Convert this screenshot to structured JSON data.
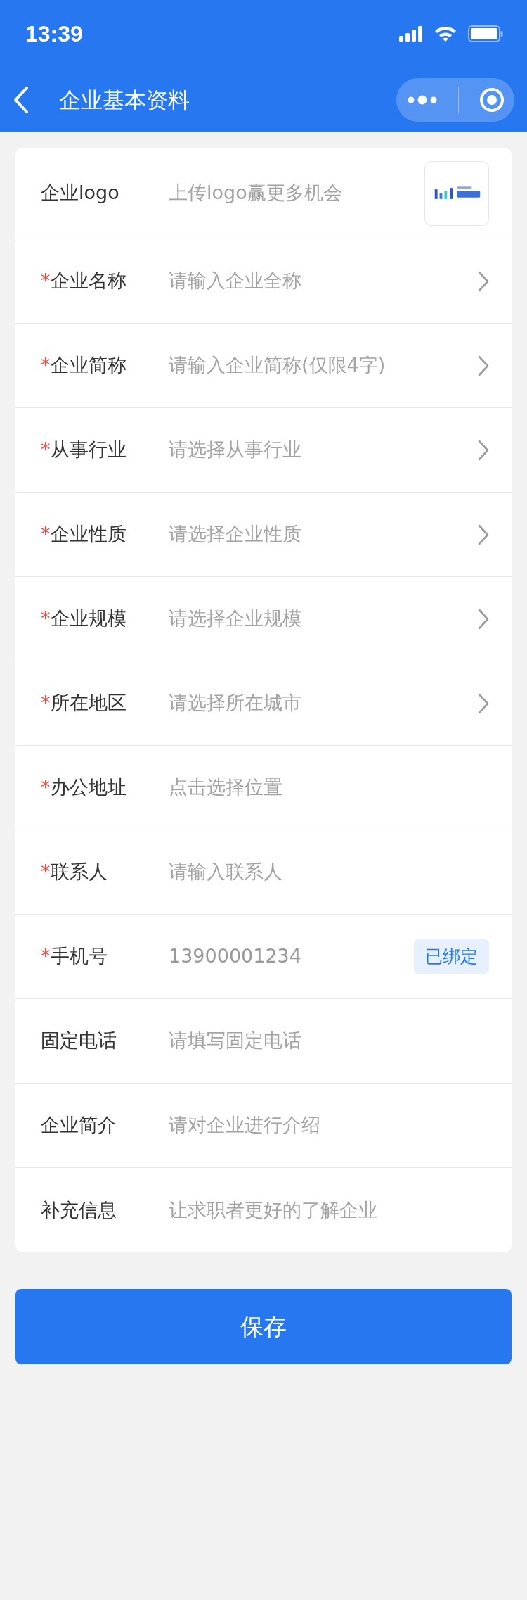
{
  "status_bar": {
    "time": "13:39"
  },
  "header": {
    "title": "企业基本资料"
  },
  "form": {
    "rows": [
      {
        "kind": "logo",
        "label": "企业logo",
        "placeholder": "上传logo赢更多机会"
      },
      {
        "kind": "select",
        "mark": "*",
        "label": "企业名称",
        "placeholder": "请输入企业全称"
      },
      {
        "kind": "select",
        "mark": "*",
        "label": "企业简称",
        "placeholder": "请输入企业简称(仅限4字)"
      },
      {
        "kind": "select",
        "mark": "*",
        "label": "从事行业",
        "placeholder": "请选择从事行业"
      },
      {
        "kind": "select",
        "mark": "*",
        "label": "企业性质",
        "placeholder": "请选择企业性质"
      },
      {
        "kind": "select",
        "mark": "*",
        "label": "企业规模",
        "placeholder": "请选择企业规模"
      },
      {
        "kind": "select",
        "mark": "*",
        "label": "所在地区",
        "placeholder": "请选择所在城市"
      },
      {
        "kind": "input",
        "mark": "*",
        "label": "办公地址",
        "placeholder": "点击选择位置"
      },
      {
        "kind": "input",
        "mark": "*",
        "label": "联系人",
        "placeholder": "请输入联系人"
      },
      {
        "kind": "phone",
        "mark": "*",
        "label": "手机号",
        "value": "13900001234",
        "badge": "已绑定"
      },
      {
        "kind": "input",
        "label": "固定电话",
        "placeholder": "请填写固定电话"
      },
      {
        "kind": "input",
        "label": "企业简介",
        "placeholder": "请对企业进行介绍"
      },
      {
        "kind": "input",
        "label": "补充信息",
        "placeholder": "让求职者更好的了解企业"
      }
    ]
  },
  "save_button": "保存"
}
